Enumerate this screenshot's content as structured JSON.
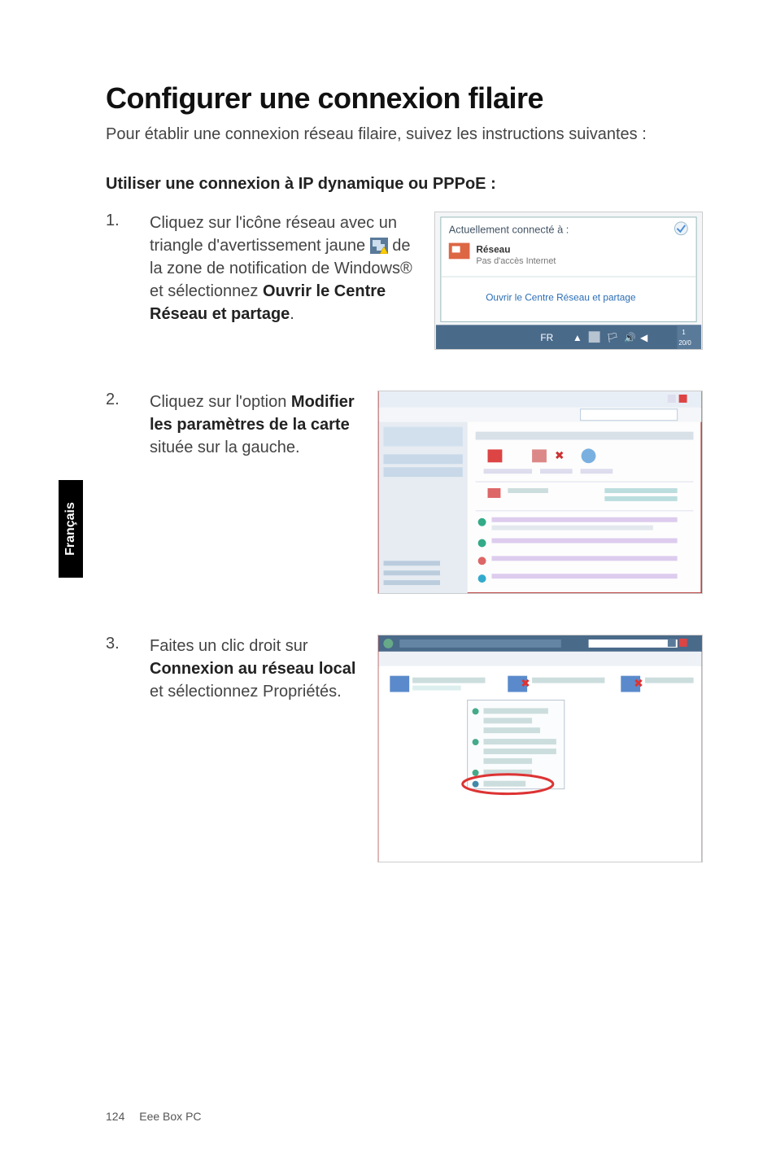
{
  "title": "Configurer une connexion filaire",
  "intro": "Pour établir une connexion réseau filaire, suivez les instructions suivantes :",
  "subheading": "Utiliser une connexion à IP dynamique ou PPPoE :",
  "steps": [
    {
      "num": "1.",
      "pre": "Cliquez sur l'icône réseau avec un triangle d'avertissement jaune ",
      "post": " de la zone de notification de Windows® et sélectionnez ",
      "bold": "Ouvrir le Centre Réseau et partage",
      "tail": "."
    },
    {
      "num": "2.",
      "pre": "Cliquez sur l'option ",
      "bold": "Modifier les paramètres de la carte",
      "post": " située sur la gauche."
    },
    {
      "num": "3.",
      "pre": "Faites un clic droit sur ",
      "bold": "Connexion au réseau local",
      "post": " et sélectionnez Propriétés."
    }
  ],
  "screenshot1": {
    "line1": "Actuellement connecté à :",
    "line2": "Réseau",
    "line3": "Pas d'accès Internet",
    "link": "Ouvrir le Centre Réseau et partage",
    "tray": "FR"
  },
  "lang_tab": "Français",
  "footer": {
    "page": "124",
    "product": "Eee Box PC"
  }
}
